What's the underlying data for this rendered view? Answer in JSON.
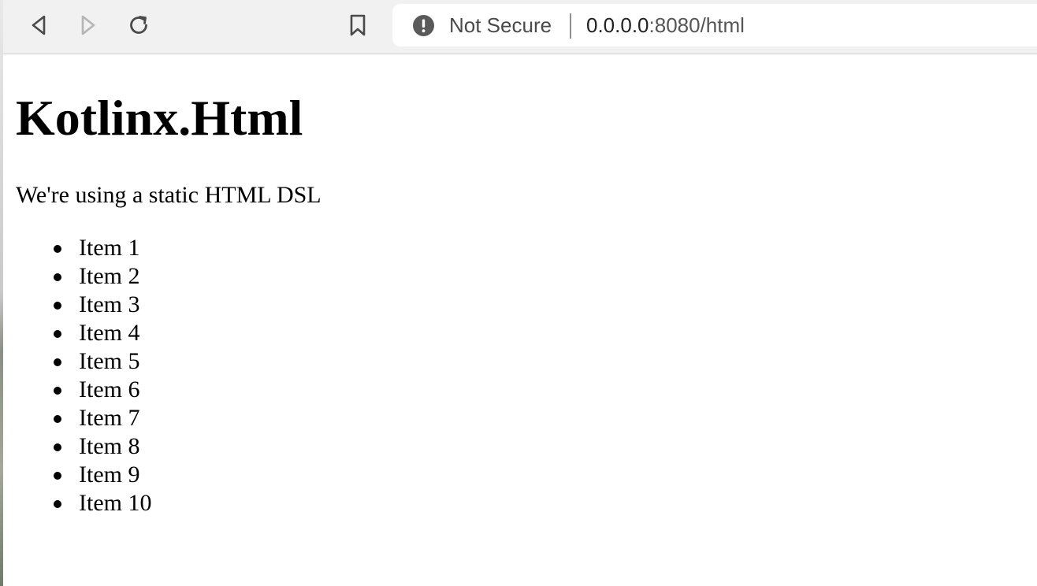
{
  "browser": {
    "back_icon": "back-arrow-icon",
    "forward_icon": "forward-arrow-icon",
    "reload_icon": "reload-icon",
    "bookmark_icon": "bookmark-icon",
    "security_icon": "info-icon",
    "security_label": "Not Secure",
    "url_host": "0.0.0.0",
    "url_rest": ":8080/html"
  },
  "page": {
    "heading": "Kotlinx.Html",
    "paragraph": "We're using a static HTML DSL",
    "items": [
      "Item 1",
      "Item 2",
      "Item 3",
      "Item 4",
      "Item 5",
      "Item 6",
      "Item 7",
      "Item 8",
      "Item 9",
      "Item 10"
    ]
  },
  "colors": {
    "toolbar_bg": "#f1f1f1",
    "page_bg": "#ffffff",
    "text": "#000000",
    "icon": "#4a4a4a",
    "icon_disabled": "#b5b5b5"
  }
}
